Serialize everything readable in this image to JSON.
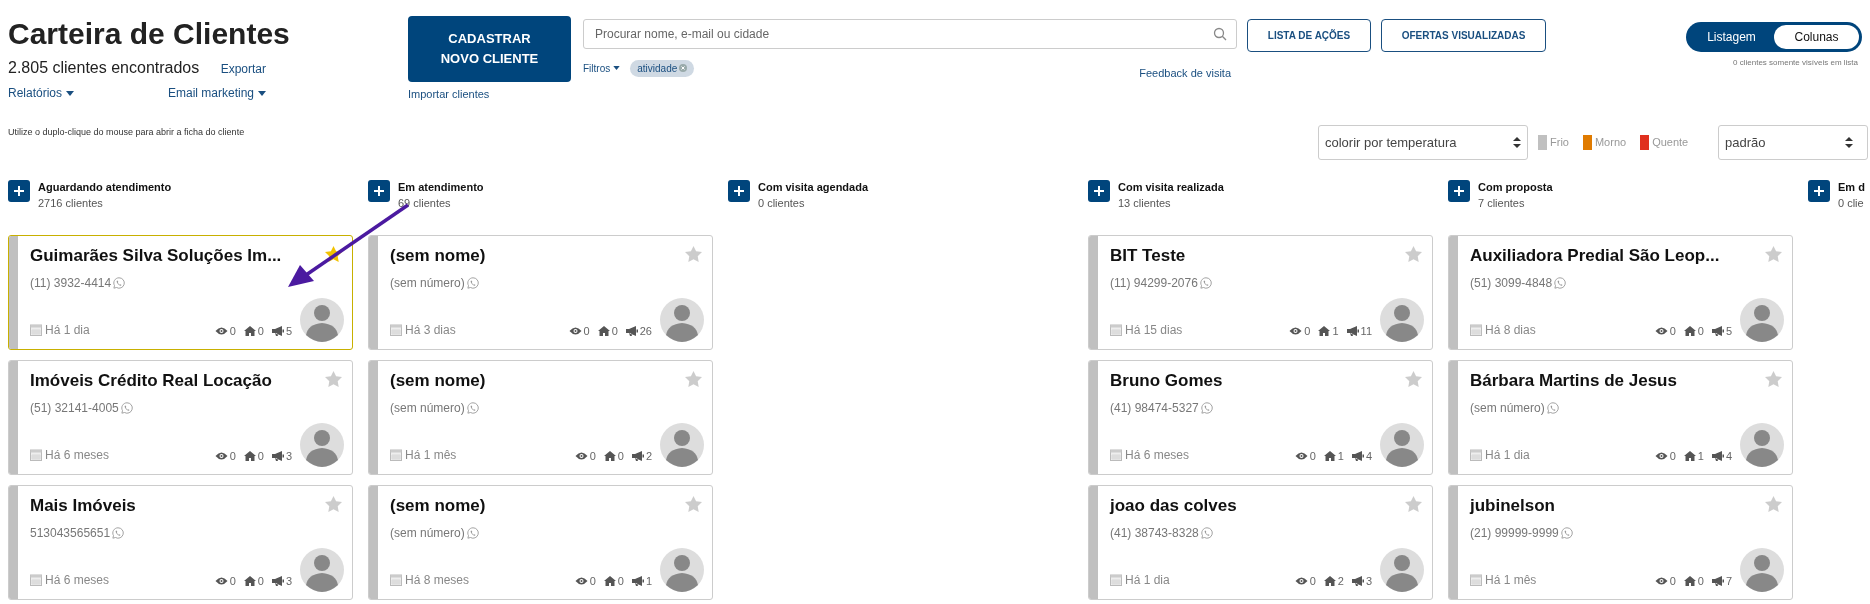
{
  "header": {
    "title": "Carteira de Clientes",
    "count": "2.805 clientes encontrados",
    "export_link": "Exportar",
    "reports_menu": "Relatórios",
    "email_menu": "Email marketing",
    "new_client_button": "CADASTRAR NOVO CLIENTE",
    "import_link": "Importar clientes",
    "hint": "Utilize o duplo-clique do mouse para abrir a ficha do cliente"
  },
  "search": {
    "placeholder": "Procurar nome, e-mail ou cidade"
  },
  "filters": {
    "label": "Filtros",
    "tags": [
      "atividade"
    ]
  },
  "feedback_link": "Feedback de visita",
  "buttons": [
    "LISTA DE AÇÕES",
    "OFERTAS VISUALIZADAS"
  ],
  "view_toggle": [
    {
      "label": "Listagem",
      "selected": false
    },
    {
      "label": "Colunas",
      "selected": true
    }
  ],
  "list_only_note": "0 clientes somente visíveis em lista",
  "color_select": "colorir por temperatura",
  "legend": [
    {
      "label": "Frio",
      "color": "#c0c0c0"
    },
    {
      "label": "Morno",
      "color": "#e07b00"
    },
    {
      "label": "Quente",
      "color": "#e0301e"
    }
  ],
  "sort_select": "padrão",
  "columns": [
    {
      "title": "Aguardando atendimento",
      "count": "2716 clientes",
      "cards": [
        {
          "name": "Guimarães Silva Soluções Im...",
          "phone": "(11) 3932-4414",
          "age": "Há 1 dia",
          "views": "0",
          "visits": "0",
          "offers": "5",
          "starred": true,
          "selected": true
        },
        {
          "name": "Imóveis Crédito Real Locação",
          "phone": "(51) 32141-4005",
          "age": "Há 6 meses",
          "views": "0",
          "visits": "0",
          "offers": "3",
          "starred": false,
          "selected": false
        },
        {
          "name": "Mais Imóveis",
          "phone": "513043565651",
          "age": "Há 6 meses",
          "views": "0",
          "visits": "0",
          "offers": "3",
          "starred": false,
          "selected": false
        }
      ]
    },
    {
      "title": "Em atendimento",
      "count": "69 clientes",
      "cards": [
        {
          "name": "(sem nome)",
          "phone": "(sem número)",
          "age": "Há 3 dias",
          "views": "0",
          "visits": "0",
          "offers": "26",
          "starred": false,
          "selected": false
        },
        {
          "name": "(sem nome)",
          "phone": "(sem número)",
          "age": "Há 1 mês",
          "views": "0",
          "visits": "0",
          "offers": "2",
          "starred": false,
          "selected": false
        },
        {
          "name": "(sem nome)",
          "phone": "(sem número)",
          "age": "Há 8 meses",
          "views": "0",
          "visits": "0",
          "offers": "1",
          "starred": false,
          "selected": false
        }
      ]
    },
    {
      "title": "Com visita agendada",
      "count": "0 clientes"
    },
    {
      "title": "Com visita realizada",
      "count": "13 clientes",
      "cards": [
        {
          "name": "BIT Teste",
          "phone": "(11) 94299-2076",
          "age": "Há 15 dias",
          "views": "0",
          "visits": "1",
          "offers": "11",
          "starred": false,
          "selected": false
        },
        {
          "name": "Bruno Gomes",
          "phone": "(41) 98474-5327",
          "age": "Há 6 meses",
          "views": "0",
          "visits": "1",
          "offers": "4",
          "starred": false,
          "selected": false
        },
        {
          "name": "joao das colves",
          "phone": "(41) 38743-8328",
          "age": "Há 1 dia",
          "views": "0",
          "visits": "2",
          "offers": "3",
          "starred": false,
          "selected": false
        }
      ]
    },
    {
      "title": "Com proposta",
      "count": "7 clientes",
      "cards": [
        {
          "name": "Auxiliadora Predial São Leop...",
          "phone": "(51) 3099-4848",
          "age": "Há 8 dias",
          "views": "0",
          "visits": "0",
          "offers": "5",
          "starred": false,
          "selected": false
        },
        {
          "name": "Bárbara Martins de Jesus",
          "phone": "(sem número)",
          "age": "Há 1 dia",
          "views": "0",
          "visits": "1",
          "offers": "4",
          "starred": false,
          "selected": false
        },
        {
          "name": "jubinelson",
          "phone": "(21) 99999-9999",
          "age": "Há 1 mês",
          "views": "0",
          "visits": "0",
          "offers": "7",
          "starred": false,
          "selected": false
        }
      ]
    },
    {
      "title": "Em d",
      "count": "0 clie"
    }
  ]
}
